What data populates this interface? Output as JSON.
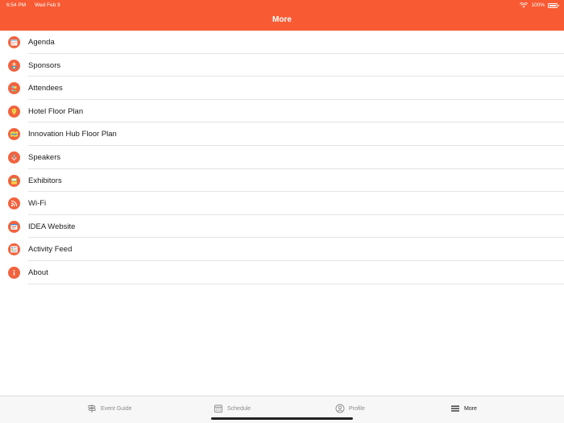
{
  "status_bar": {
    "time": "6:54 PM",
    "date": "Wed Feb 9",
    "battery": "100%"
  },
  "header": {
    "title": "More"
  },
  "menu": [
    {
      "label": "Agenda",
      "icon": "calendar-icon"
    },
    {
      "label": "Sponsors",
      "icon": "sponsor-icon"
    },
    {
      "label": "Attendees",
      "icon": "attendees-icon"
    },
    {
      "label": "Hotel Floor Plan",
      "icon": "map-pin-icon"
    },
    {
      "label": "Innovation Hub Floor Plan",
      "icon": "floor-plan-icon"
    },
    {
      "label": "Speakers",
      "icon": "speaker-icon"
    },
    {
      "label": "Exhibitors",
      "icon": "booth-icon"
    },
    {
      "label": "Wi-Fi",
      "icon": "wifi-icon"
    },
    {
      "label": "IDEA Website",
      "icon": "website-icon"
    },
    {
      "label": "Activity Feed",
      "icon": "feed-icon"
    },
    {
      "label": "About",
      "icon": "info-icon"
    }
  ],
  "tabs": [
    {
      "label": "Event Guide",
      "icon": "signpost-icon"
    },
    {
      "label": "Schedule",
      "icon": "calendar-icon"
    },
    {
      "label": "Profile",
      "icon": "profile-icon"
    },
    {
      "label": "More",
      "icon": "menu-icon"
    }
  ],
  "colors": {
    "accent": "#f85a33",
    "icon_bg": "#f2623e",
    "tab_active": "#222222",
    "tab_inactive": "#8a8a8a"
  }
}
